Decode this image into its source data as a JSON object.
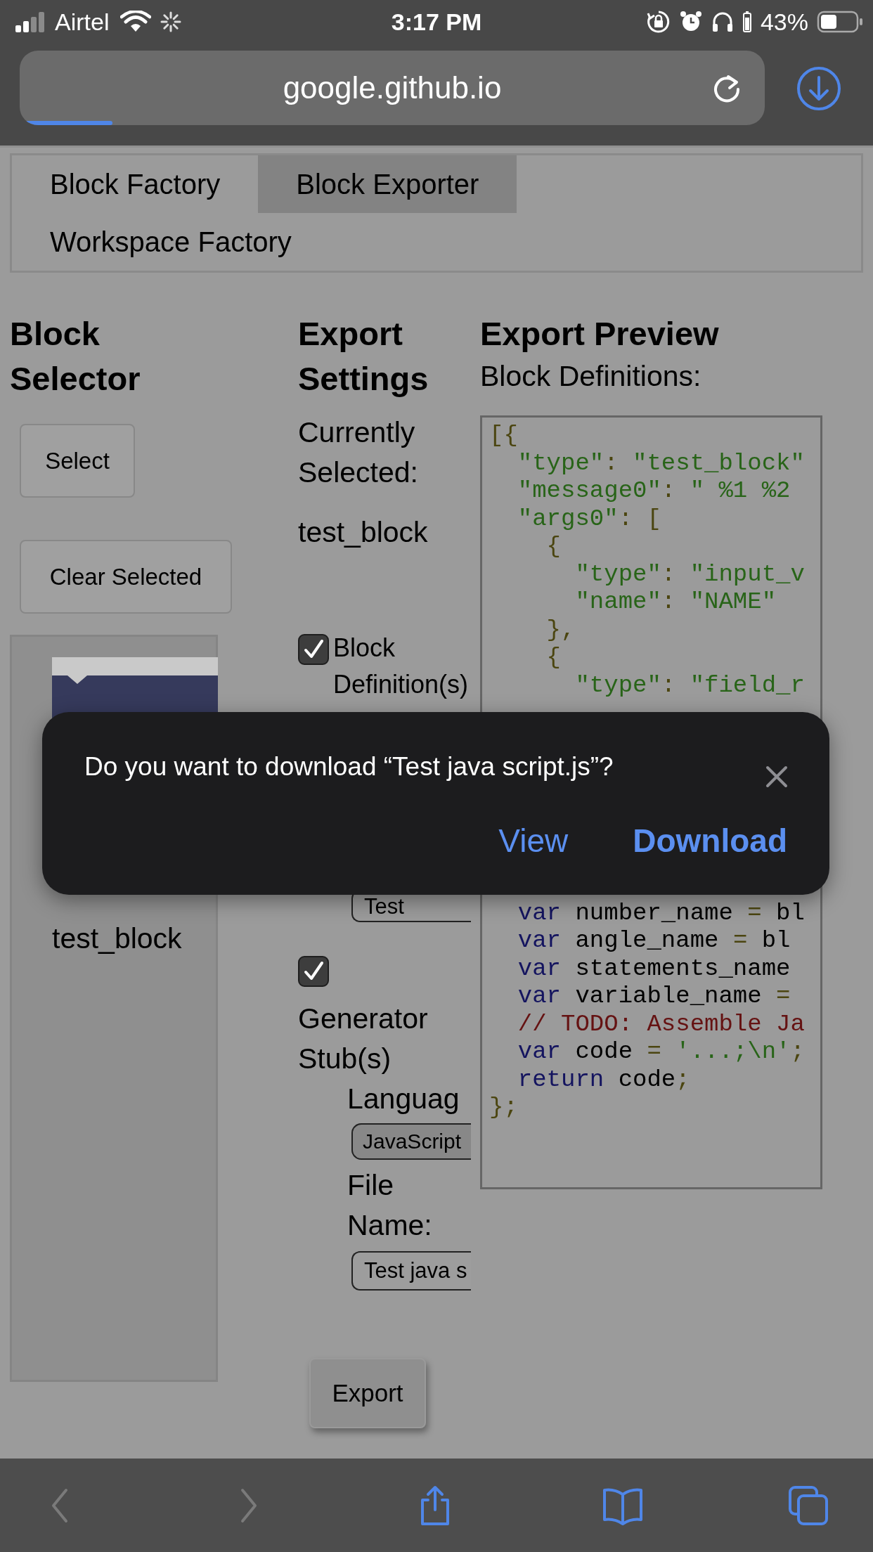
{
  "status_bar": {
    "carrier": "Airtel",
    "time": "3:17 PM",
    "battery": "43%"
  },
  "address_bar": {
    "url": "google.github.io",
    "level": 0.12
  },
  "tabs": [
    {
      "label": "Block Factory",
      "selected": false
    },
    {
      "label": "Block Exporter",
      "selected": true
    },
    {
      "label": "Workspace Factory",
      "selected": false
    }
  ],
  "block_selector": {
    "title": "Block Selector",
    "buttons": [
      "Select",
      "Clear Selected"
    ],
    "block_label": "test_block"
  },
  "export_settings": {
    "title": "Export Settings",
    "current_label": "Currently Selected:",
    "current_value": "test_block",
    "block_definitions": {
      "label": "Block Definition(s)",
      "checked": true,
      "file_name_value": "Test"
    },
    "generator_stubs": {
      "label": "Generator Stub(s)",
      "checked": true,
      "language_label": "Languag",
      "language": "JavaScript",
      "file_name_label": "File Name:",
      "file_name_value": "Test java s"
    },
    "export_button": "Export"
  },
  "export_preview": {
    "title": "Export Preview",
    "subtitle": "Block Definitions:",
    "code_top": [
      [
        {
          "kind": "p",
          "text": "[{"
        }
      ],
      [
        {
          "kind": "s",
          "text": "  \"type\""
        },
        {
          "kind": "p",
          "text": ": "
        },
        {
          "kind": "s",
          "text": "\"test_block\""
        }
      ],
      [
        {
          "kind": "s",
          "text": "  \"message0\""
        },
        {
          "kind": "p",
          "text": ": "
        },
        {
          "kind": "s",
          "text": "\" %1 %2"
        }
      ],
      [
        {
          "kind": "s",
          "text": "  \"args0\""
        },
        {
          "kind": "p",
          "text": ": ["
        }
      ],
      [
        {
          "kind": "p",
          "text": "    {"
        }
      ],
      [
        {
          "kind": "s",
          "text": "      \"type\""
        },
        {
          "kind": "p",
          "text": ": "
        },
        {
          "kind": "s",
          "text": "\"input_v"
        }
      ],
      [
        {
          "kind": "s",
          "text": "      \"name\""
        },
        {
          "kind": "p",
          "text": ": "
        },
        {
          "kind": "s",
          "text": "\"NAME\""
        }
      ],
      [
        {
          "kind": "p",
          "text": "    },"
        }
      ],
      [
        {
          "kind": "p",
          "text": "    {"
        }
      ],
      [
        {
          "kind": "s",
          "text": "      \"type\""
        },
        {
          "kind": "p",
          "text": ": "
        },
        {
          "kind": "s",
          "text": "\"field_r"
        }
      ]
    ],
    "code_bottom": [
      [
        {
          "kind": "k",
          "text": "  var"
        },
        {
          "kind": "t",
          "text": " number_name "
        },
        {
          "kind": "p",
          "text": "="
        },
        {
          "kind": "t",
          "text": " bl"
        }
      ],
      [
        {
          "kind": "k",
          "text": "  var"
        },
        {
          "kind": "t",
          "text": " angle_name "
        },
        {
          "kind": "p",
          "text": "="
        },
        {
          "kind": "t",
          "text": " bl"
        }
      ],
      [
        {
          "kind": "k",
          "text": "  var"
        },
        {
          "kind": "t",
          "text": " statements_name"
        }
      ],
      [
        {
          "kind": "k",
          "text": "  var"
        },
        {
          "kind": "t",
          "text": " variable_name "
        },
        {
          "kind": "p",
          "text": "="
        }
      ],
      [
        {
          "kind": "c",
          "text": "  // TODO: Assemble Ja"
        }
      ],
      [
        {
          "kind": "k",
          "text": "  var"
        },
        {
          "kind": "t",
          "text": " code "
        },
        {
          "kind": "p",
          "text": "="
        },
        {
          "kind": "s",
          "text": " '...;\\n'"
        },
        {
          "kind": "p",
          "text": ";"
        }
      ],
      [
        {
          "kind": "k",
          "text": "  return"
        },
        {
          "kind": "t",
          "text": " code"
        },
        {
          "kind": "p",
          "text": ";"
        }
      ],
      [
        {
          "kind": "p",
          "text": "};"
        }
      ]
    ]
  },
  "dialog": {
    "message": "Do you want to download “Test java script.js”?",
    "actions": [
      {
        "label": "View",
        "primary": false
      },
      {
        "label": "Download",
        "primary": true
      }
    ]
  },
  "toolbar": [
    {
      "kind": "back",
      "disabled": true
    },
    {
      "kind": "forward",
      "disabled": true
    },
    {
      "kind": "share",
      "disabled": false
    },
    {
      "kind": "bookmarks",
      "disabled": false
    },
    {
      "kind": "tabs",
      "disabled": false
    }
  ]
}
